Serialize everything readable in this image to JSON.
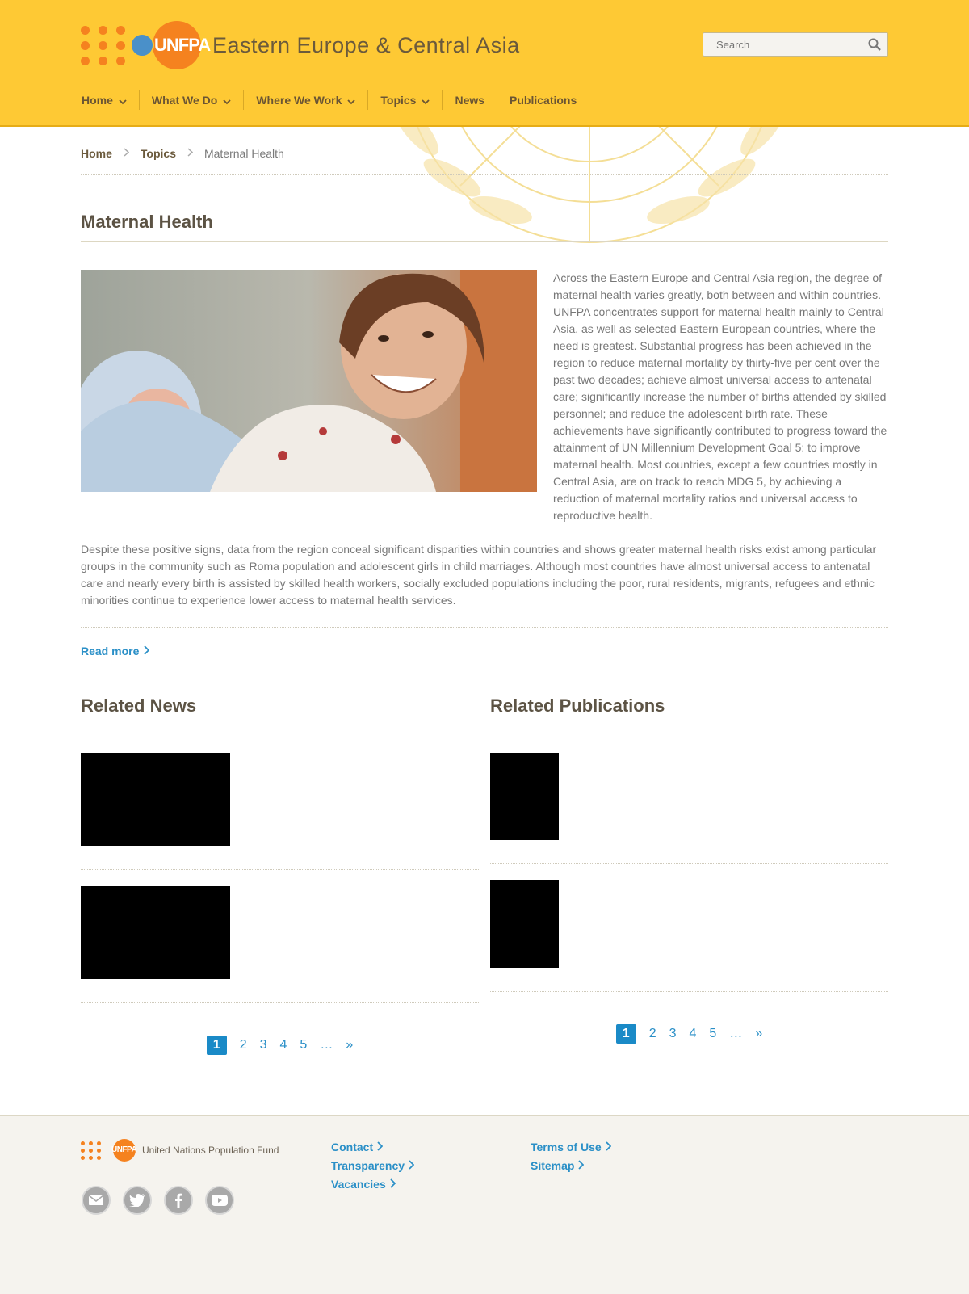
{
  "header": {
    "logo_text": "UNFPA",
    "site_name": "Eastern Europe & Central Asia",
    "search_placeholder": "Search"
  },
  "nav": [
    {
      "label": "Home",
      "dropdown": true
    },
    {
      "label": "What We Do",
      "dropdown": true
    },
    {
      "label": "Where We Work",
      "dropdown": true
    },
    {
      "label": "Topics",
      "dropdown": true
    },
    {
      "label": "News",
      "dropdown": false
    },
    {
      "label": "Publications",
      "dropdown": false
    }
  ],
  "breadcrumb": {
    "home": "Home",
    "topics": "Topics",
    "current": "Maternal Health"
  },
  "page": {
    "title": "Maternal Health",
    "intro": "Across the Eastern Europe and Central Asia region, the degree of maternal health varies greatly, both between and within countries. UNFPA concentrates support for maternal health mainly to Central Asia, as well as selected Eastern European countries, where the need is greatest. Substantial progress has been achieved in the region to reduce maternal mortality by thirty-five per cent over the past two decades; achieve almost universal access to antenatal care; significantly increase the number of births attended by skilled personnel; and reduce the adolescent birth rate. These achievements have significantly contributed to progress toward the attainment of UN Millennium Development Goal 5: to improve maternal health. Most countries, except a few countries mostly in Central Asia, are on track to reach MDG 5, by achieving a reduction of maternal mortality ratios and universal access to reproductive health.",
    "body": "Despite these positive signs, data from the region conceal significant disparities within countries and shows greater maternal health risks exist among particular groups in the community such as Roma population and adolescent girls in child marriages. Although most countries have almost universal access to antenatal care and nearly every birth is assisted by skilled health workers, socially excluded populations including the poor, rural residents, migrants, refugees and ethnic minorities continue to experience lower access to maternal health services.",
    "read_more": "Read more"
  },
  "related_news": {
    "title": "Related News",
    "pager": {
      "active": "1",
      "pages": [
        "2",
        "3",
        "4",
        "5"
      ],
      "ellipsis": "…",
      "next": "»"
    }
  },
  "related_publications": {
    "title": "Related Publications",
    "pager": {
      "active": "1",
      "pages": [
        "2",
        "3",
        "4",
        "5"
      ],
      "ellipsis": "…",
      "next": "»"
    }
  },
  "footer": {
    "org_name": "United Nations Population Fund",
    "logo_text": "UNFPA",
    "links_col1": [
      "Contact",
      "Transparency",
      "Vacancies"
    ],
    "links_col2": [
      "Terms of Use",
      "Sitemap"
    ]
  },
  "colors": {
    "header_bg": "#fec934",
    "accent_orange": "#f5821f",
    "link_blue": "#2a8fc7"
  }
}
